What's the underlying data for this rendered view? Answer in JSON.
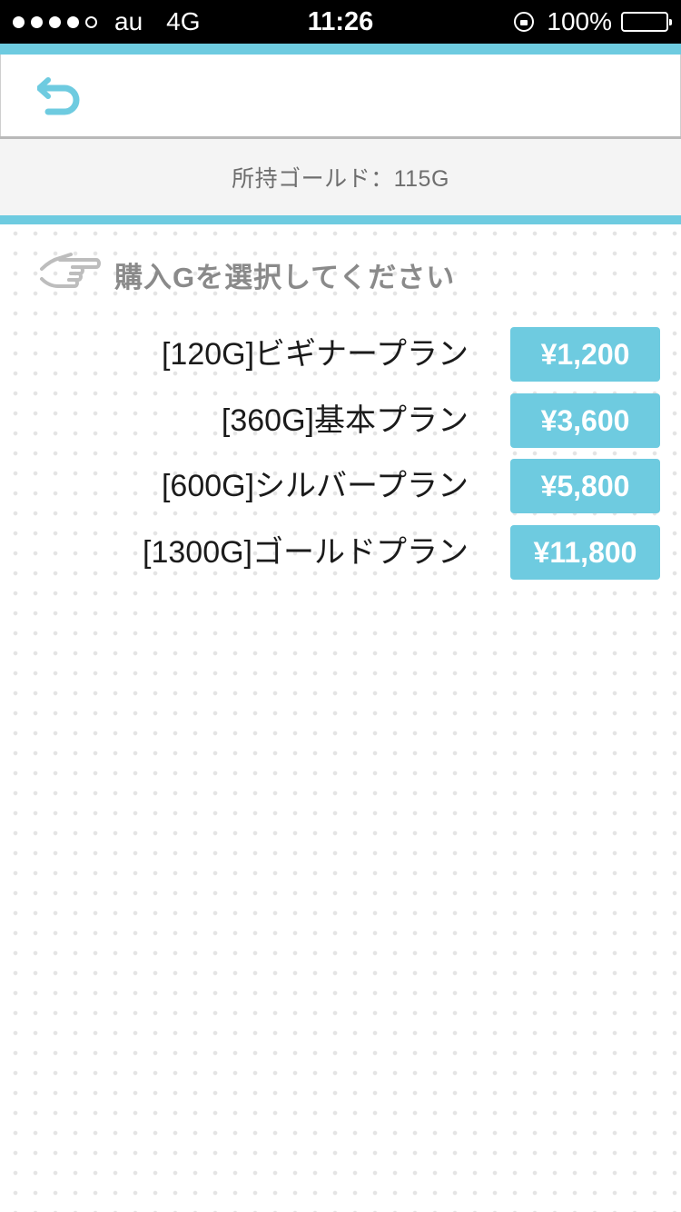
{
  "status_bar": {
    "carrier": "au",
    "network": "4G",
    "time": "11:26",
    "battery": "100%",
    "signal_bars_filled": 4,
    "signal_bars_total": 5
  },
  "header": {
    "back_icon": "undo-arrow-icon"
  },
  "gold": {
    "label": "所持ゴールド：115G"
  },
  "instruction": {
    "icon": "pointing-hand-icon",
    "text": "購入Gを選択してください"
  },
  "plans": [
    {
      "name": "[120G]ビギナープラン",
      "price": "¥1,200"
    },
    {
      "name": "[360G]基本プラン",
      "price": "¥3,600"
    },
    {
      "name": "[600G]シルバープラン",
      "price": "¥5,800"
    },
    {
      "name": "[1300G]ゴールドプラン",
      "price": "¥11,800"
    }
  ],
  "colors": {
    "accent": "#6ecbe0",
    "gold_bar_bg": "#f4f4f4",
    "instruction_text": "#8a8a8a"
  }
}
